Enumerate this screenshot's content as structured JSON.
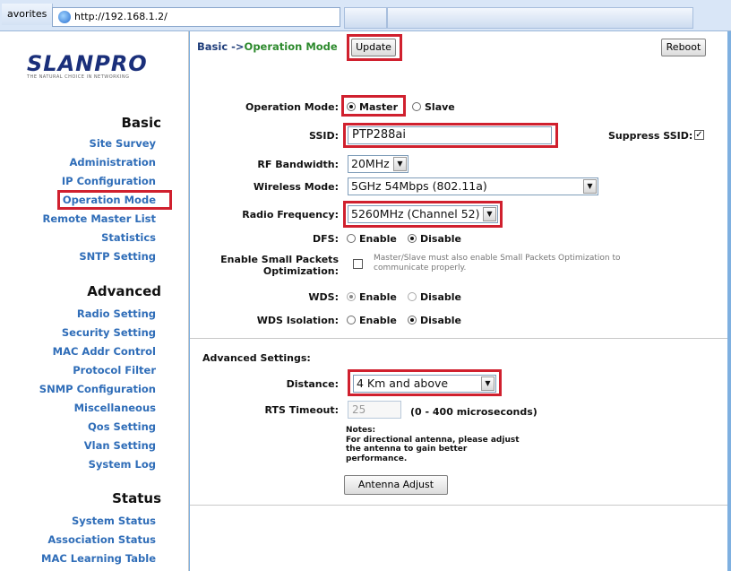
{
  "browser": {
    "favorites_label": "avorites",
    "address": "http://192.168.1.2/"
  },
  "logo": {
    "text": "SLANPRO",
    "tagline": "THE NATURAL CHOICE IN NETWORKING"
  },
  "sidebar": {
    "basic": {
      "title": "Basic",
      "items": [
        "Site Survey",
        "Administration",
        "IP Configuration",
        "Operation Mode",
        "Remote Master List",
        "Statistics",
        "SNTP Setting"
      ]
    },
    "advanced": {
      "title": "Advanced",
      "items": [
        "Radio Setting",
        "Security Setting",
        "MAC Addr Control",
        "Protocol Filter",
        "SNMP Configuration",
        "Miscellaneous",
        "Qos Setting",
        "Vlan Setting",
        "System Log"
      ]
    },
    "status": {
      "title": "Status",
      "items": [
        "System Status",
        "Association Status",
        "MAC Learning Table"
      ]
    }
  },
  "header": {
    "crumb_prefix": "Basic ->",
    "crumb_current": "Operation Mode",
    "update_label": "Update",
    "reboot_label": "Reboot"
  },
  "form": {
    "operation_mode": {
      "label": "Operation Mode:",
      "options": [
        "Master",
        "Slave"
      ],
      "selected": "Master"
    },
    "ssid": {
      "label": "SSID:",
      "value": "PTP288ai"
    },
    "suppress_ssid": {
      "label": "Suppress SSID:",
      "checked": true
    },
    "rf_bandwidth": {
      "label": "RF Bandwidth:",
      "value": "20MHz"
    },
    "wireless_mode": {
      "label": "Wireless Mode:",
      "value": "5GHz 54Mbps (802.11a)"
    },
    "radio_frequency": {
      "label": "Radio Frequency:",
      "value": "5260MHz (Channel 52)"
    },
    "dfs": {
      "label": "DFS:",
      "options": [
        "Enable",
        "Disable"
      ],
      "selected": "Disable"
    },
    "small_packets": {
      "label_line1": "Enable Small Packets",
      "label_line2": "Optimization:",
      "note_line1": "Master/Slave must also enable Small Packets Optimization to",
      "note_line2": "communicate properly.",
      "checked": false
    },
    "wds": {
      "label": "WDS:",
      "options": [
        "Enable",
        "Disable"
      ],
      "selected": "Enable"
    },
    "wds_isolation": {
      "label": "WDS Isolation:",
      "options": [
        "Enable",
        "Disable"
      ],
      "selected": "Disable"
    }
  },
  "advanced": {
    "heading": "Advanced Settings:",
    "distance": {
      "label": "Distance:",
      "value": "4 Km and above"
    },
    "rts_timeout": {
      "label": "RTS Timeout:",
      "value": "25",
      "range": "(0 - 400 microseconds)"
    },
    "notes": [
      "Notes:",
      "For directional antenna, please adjust",
      "the antenna to gain better",
      "performance."
    ],
    "antenna_button": "Antenna Adjust"
  },
  "colors": {
    "highlight_box": "#d0202e",
    "nav_link": "#2f6db8",
    "crumb_current": "#2d8a2d"
  }
}
